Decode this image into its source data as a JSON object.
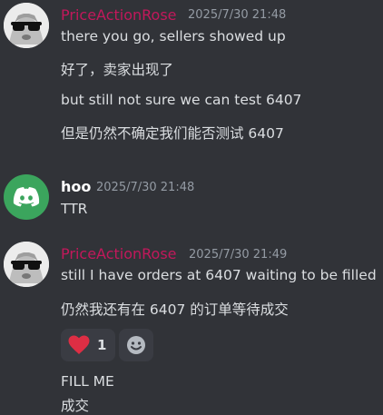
{
  "messages": [
    {
      "author": "PriceActionRose",
      "timestamp": "2025/7/30 21:48",
      "lines": [
        "there you go, sellers showed up",
        "好了，卖家出现了",
        "but still  not sure we can test 6407",
        "但是仍然不确定我们能否测试 6407"
      ]
    },
    {
      "author": "hoo",
      "timestamp": "2025/7/30 21:48",
      "lines": [
        "TTR"
      ]
    },
    {
      "author": "PriceActionRose",
      "timestamp": "2025/7/30 21:49",
      "lines": [
        "still I have orders at 6407 waiting to be filled",
        "仍然我还有在 6407 的订单等待成交"
      ],
      "reaction": {
        "emoji": "heart",
        "count": "1"
      },
      "after_lines": [
        "FILL ME",
        "成交"
      ]
    }
  ],
  "colors": {
    "background": "#313338",
    "rose_name": "#c2185b",
    "discord_green": "#3ba55d"
  }
}
